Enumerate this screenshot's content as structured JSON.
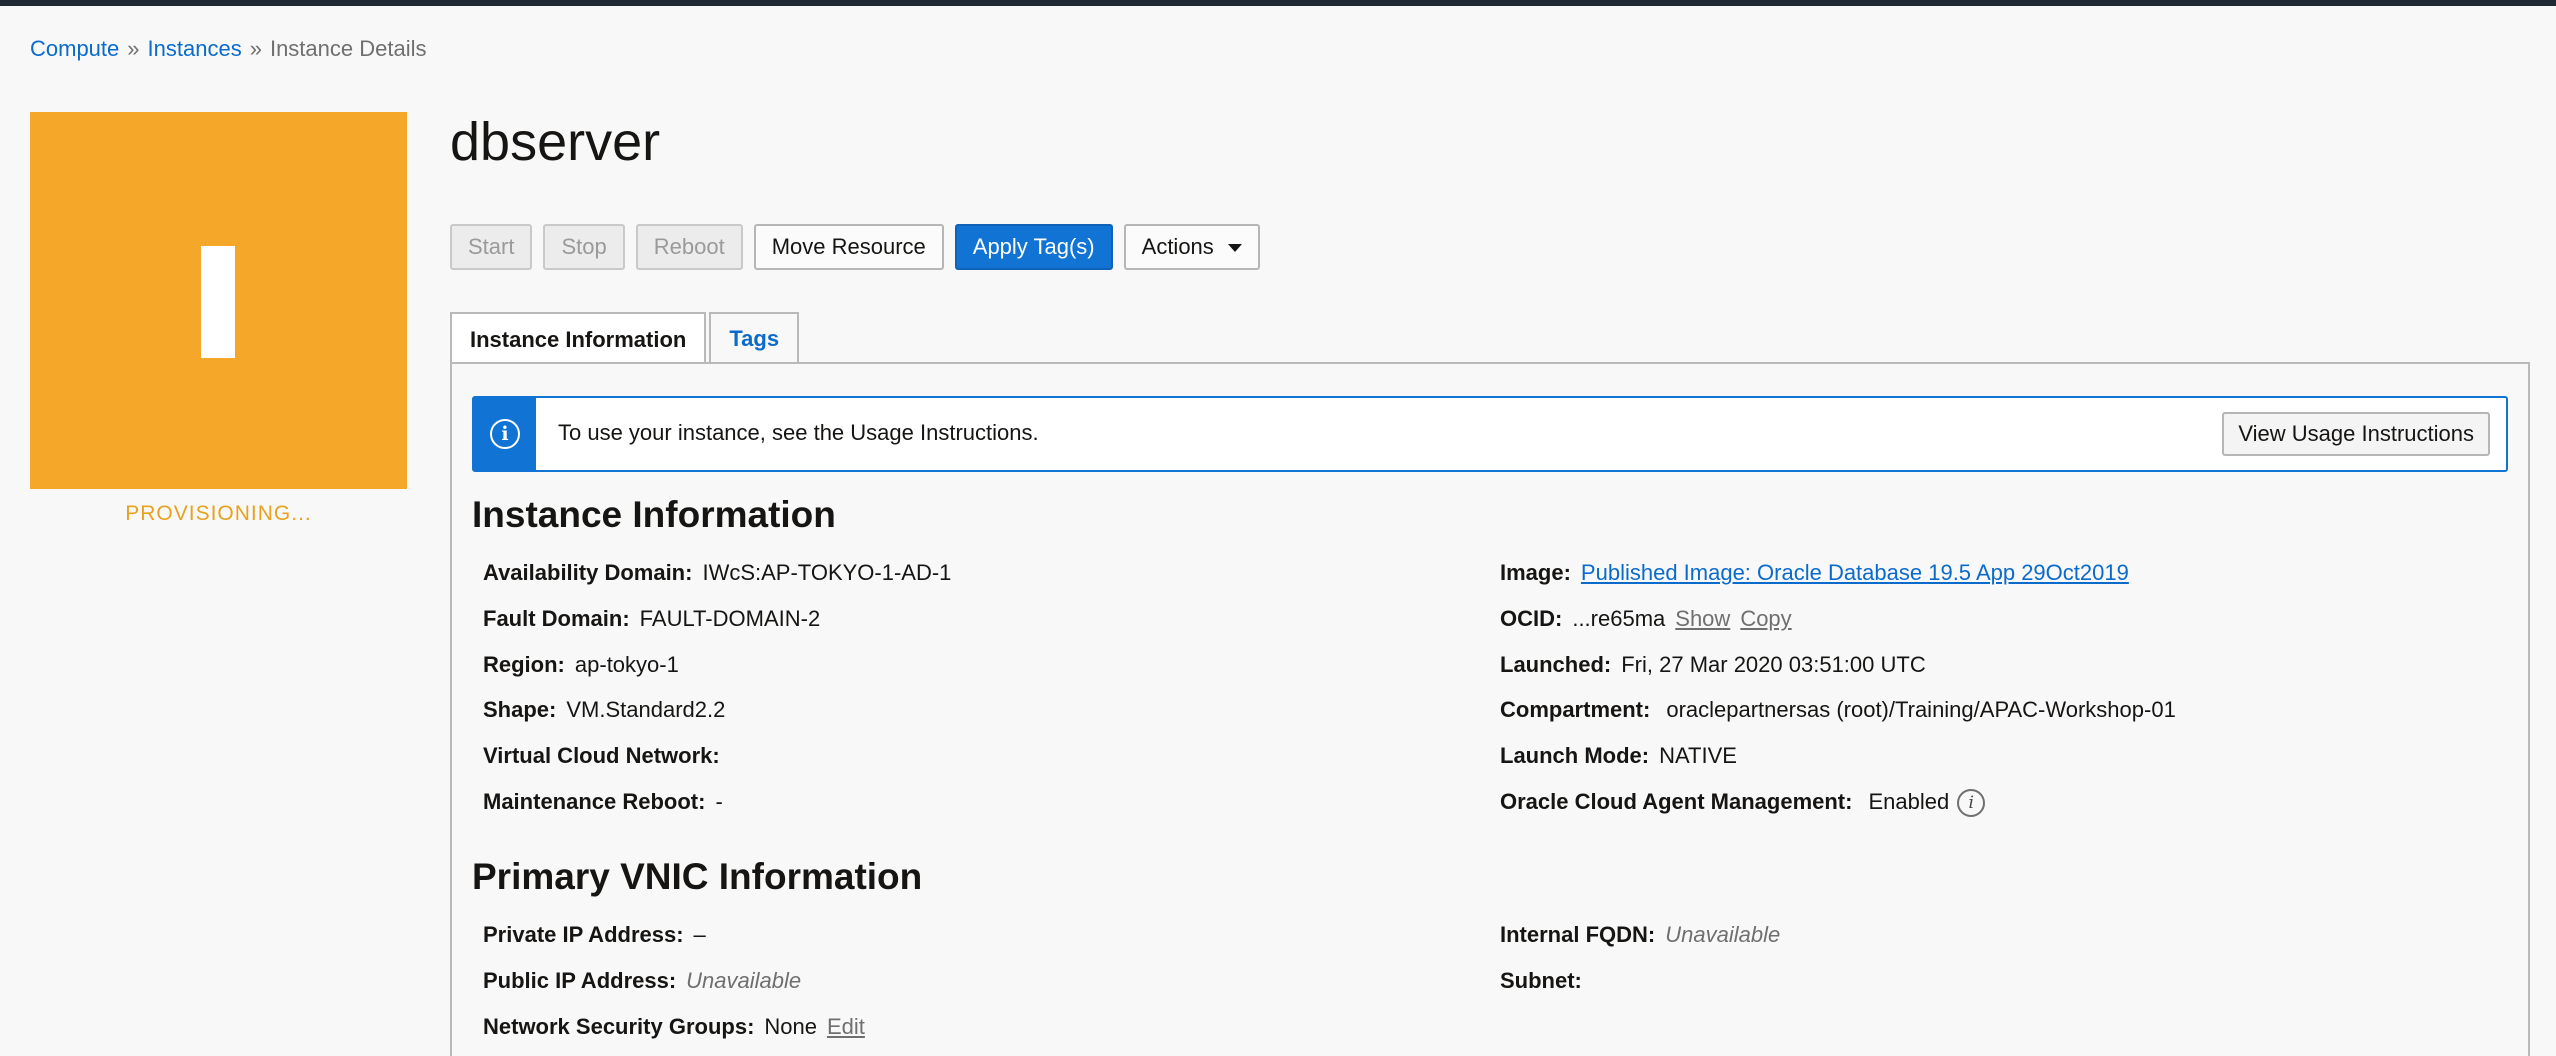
{
  "breadcrumb": {
    "items": [
      "Compute",
      "Instances",
      "Instance Details"
    ],
    "separator": "»"
  },
  "instance": {
    "tile_letter_color": "#ffffff",
    "tile_color": "#f5a72a",
    "state": "PROVISIONING...",
    "name": "dbserver"
  },
  "toolbar": {
    "start": "Start",
    "stop": "Stop",
    "reboot": "Reboot",
    "move_resource": "Move Resource",
    "apply_tags": "Apply Tag(s)",
    "actions": "Actions"
  },
  "tabs": {
    "instance_information": "Instance Information",
    "tags": "Tags"
  },
  "notice": {
    "icon": "info-icon",
    "text": "To use your instance, see the Usage Instructions.",
    "button": "View Usage Instructions"
  },
  "instance_info": {
    "title": "Instance Information",
    "availability_domain": {
      "label": "Availability Domain:",
      "value": "IWcS:AP-TOKYO-1-AD-1"
    },
    "fault_domain": {
      "label": "Fault Domain:",
      "value": "FAULT-DOMAIN-2"
    },
    "region": {
      "label": "Region:",
      "value": "ap-tokyo-1"
    },
    "shape": {
      "label": "Shape:",
      "value": "VM.Standard2.2"
    },
    "vcn": {
      "label": "Virtual Cloud Network:",
      "value": ""
    },
    "maintenance_reboot": {
      "label": "Maintenance Reboot:",
      "value": "-"
    },
    "image": {
      "label": "Image:",
      "value": "Published Image: Oracle Database 19.5 App 29Oct2019"
    },
    "ocid": {
      "label": "OCID:",
      "value": "...re65ma",
      "show": "Show",
      "copy": "Copy"
    },
    "launched": {
      "label": "Launched:",
      "value": "Fri, 27 Mar 2020 03:51:00 UTC"
    },
    "compartment": {
      "label": "Compartment:",
      "value": "oraclepartnersas (root)/Training/APAC-Workshop-01"
    },
    "launch_mode": {
      "label": "Launch Mode:",
      "value": "NATIVE"
    },
    "agent_management": {
      "label": "Oracle Cloud Agent Management:",
      "value": "Enabled",
      "info": "i"
    }
  },
  "vnic_info": {
    "title": "Primary VNIC Information",
    "private_ip": {
      "label": "Private IP Address:",
      "value": "–"
    },
    "public_ip": {
      "label": "Public IP Address:",
      "value": "Unavailable"
    },
    "nsg": {
      "label": "Network Security Groups:",
      "value": "None",
      "edit": "Edit"
    },
    "internal_fqdn": {
      "label": "Internal FQDN:",
      "value": "Unavailable"
    },
    "subnet": {
      "label": "Subnet:",
      "value": ""
    }
  },
  "colors": {
    "accent_blue": "#1173d4",
    "link_blue": "#0b6bcb",
    "provisioning_orange": "#f5a72a"
  }
}
